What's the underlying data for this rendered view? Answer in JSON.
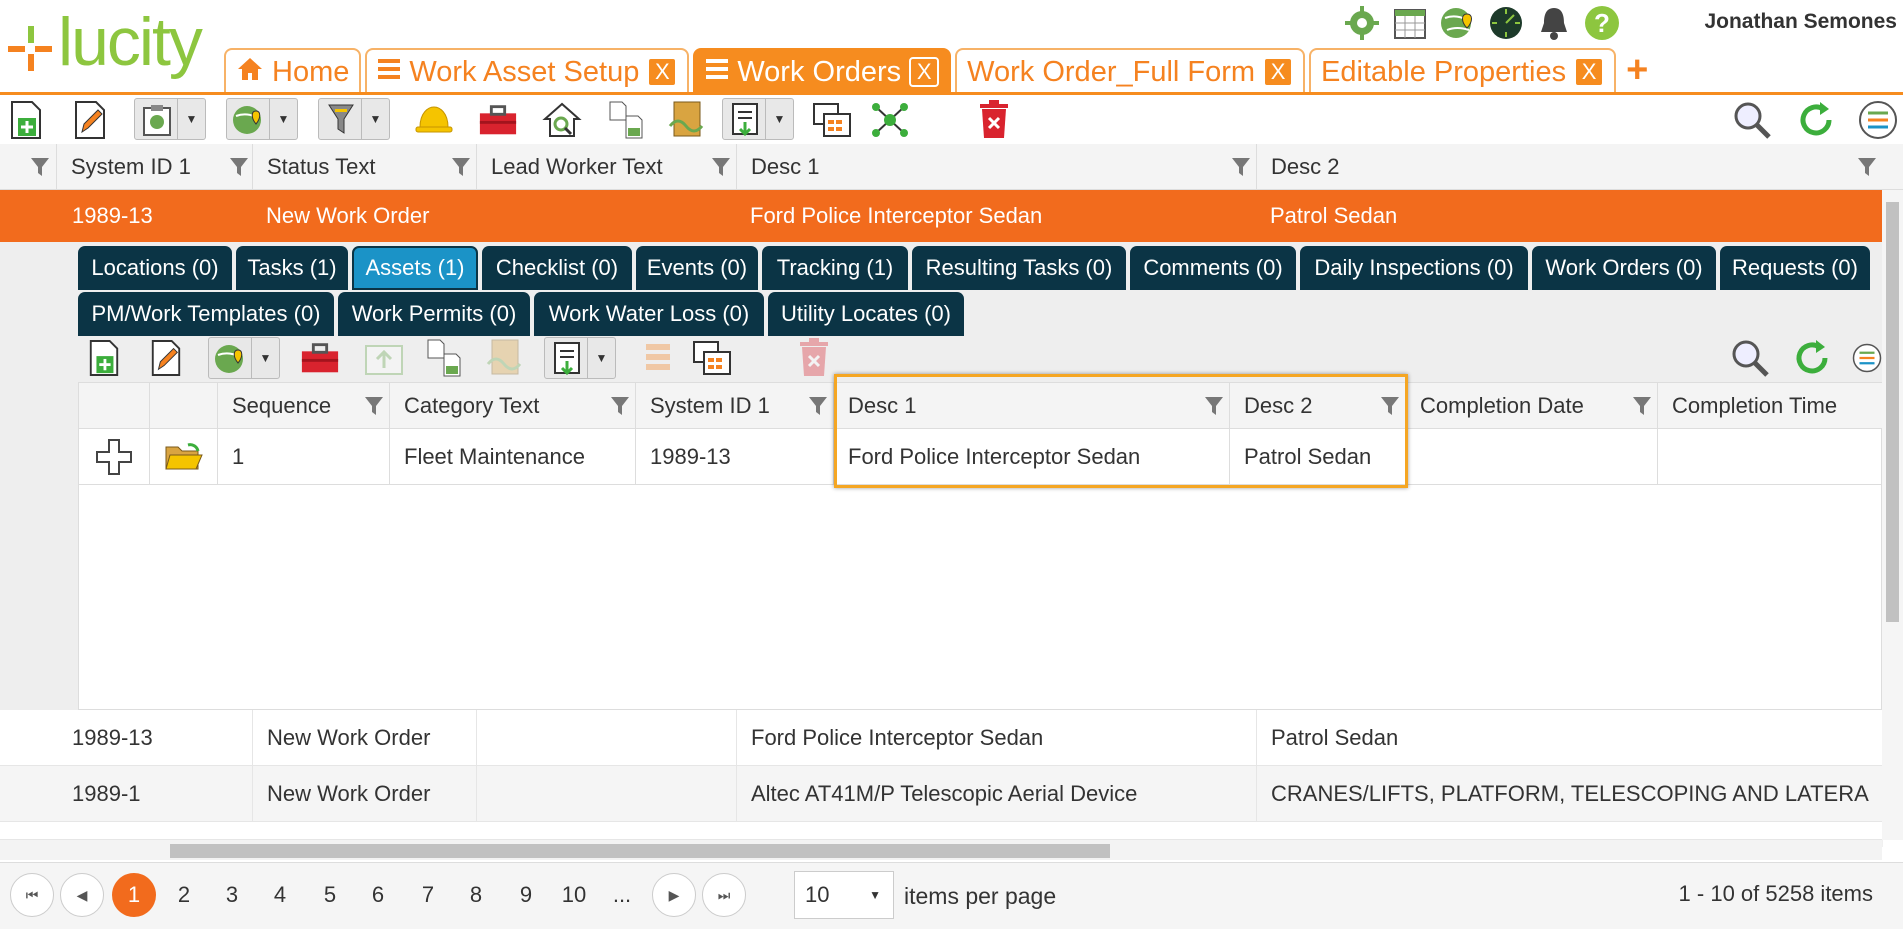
{
  "app": {
    "logo_text": "lucity",
    "user_name": "Jonathan Semones",
    "colors": {
      "accent": "#f68c1f",
      "selected_row": "#f26b1d",
      "subtab": "#0b3445",
      "subtab_active": "#1b93c7",
      "logo_green": "#8dc63f",
      "highlight": "#f5a623"
    }
  },
  "header_icons": [
    "gear-icon",
    "calendar-icon",
    "map-pin-icon",
    "dashboard-icon",
    "bell-icon",
    "help-icon"
  ],
  "tabs": [
    {
      "label": "Home",
      "icon": "home-icon",
      "closable": false,
      "active": false
    },
    {
      "label": "Work Asset Setup",
      "icon": "list-icon",
      "closable": true,
      "active": false
    },
    {
      "label": "Work Orders",
      "icon": "list-icon",
      "closable": true,
      "active": true
    },
    {
      "label": "Work Order_Full Form",
      "closable": true,
      "active": false
    },
    {
      "label": "Editable Properties",
      "closable": true,
      "active": false
    }
  ],
  "tab_close_label": "X",
  "tab_add_label": "+",
  "grid": {
    "columns": [
      "System ID 1",
      "Status Text",
      "Lead Worker Text",
      "Desc 1",
      "Desc 2"
    ],
    "selected_row": [
      "1989-13",
      "New Work Order",
      "",
      "Ford Police Interceptor Sedan",
      "Patrol Sedan"
    ],
    "rows": [
      [
        "1989-13",
        "New Work Order",
        "",
        "Ford Police Interceptor Sedan",
        "Patrol Sedan"
      ],
      [
        "1989-1",
        "New Work Order",
        "",
        "Altec AT41M/P Telescopic Aerial Device",
        "CRANES/LIFTS, PLATFORM, TELESCOPING AND LATERA"
      ],
      [
        "1989-1",
        "New Work Order",
        "",
        "Altec AT41M/P Telescopic Aerial Device",
        "CRANES/LIFTS, PLATFORM, TELESCOPING AND LATERA"
      ]
    ]
  },
  "subtabs": [
    "Locations (0)",
    "Tasks (1)",
    "Assets (1)",
    "Checklist (0)",
    "Events (0)",
    "Tracking (1)",
    "Resulting Tasks (0)",
    "Comments (0)",
    "Daily Inspections (0)",
    "Work Orders (0)",
    "Requests (0)",
    "PM/Work Templates (0)",
    "Work Permits (0)",
    "Work Water Loss (0)",
    "Utility Locates (0)"
  ],
  "subgrid": {
    "columns": [
      "Sequence",
      "Category Text",
      "System ID 1",
      "Desc 1",
      "Desc 2",
      "Completion Date",
      "Completion Time"
    ],
    "row": [
      "1",
      "Fleet Maintenance",
      "1989-13",
      "Ford Police Interceptor Sedan",
      "Patrol Sedan",
      "",
      ""
    ]
  },
  "pager": {
    "pages": [
      "1",
      "2",
      "3",
      "4",
      "5",
      "6",
      "7",
      "8",
      "9",
      "10",
      "..."
    ],
    "current": "1",
    "per_page": "10",
    "per_page_label": "items per page",
    "summary": "1 - 10 of 5258 items"
  }
}
